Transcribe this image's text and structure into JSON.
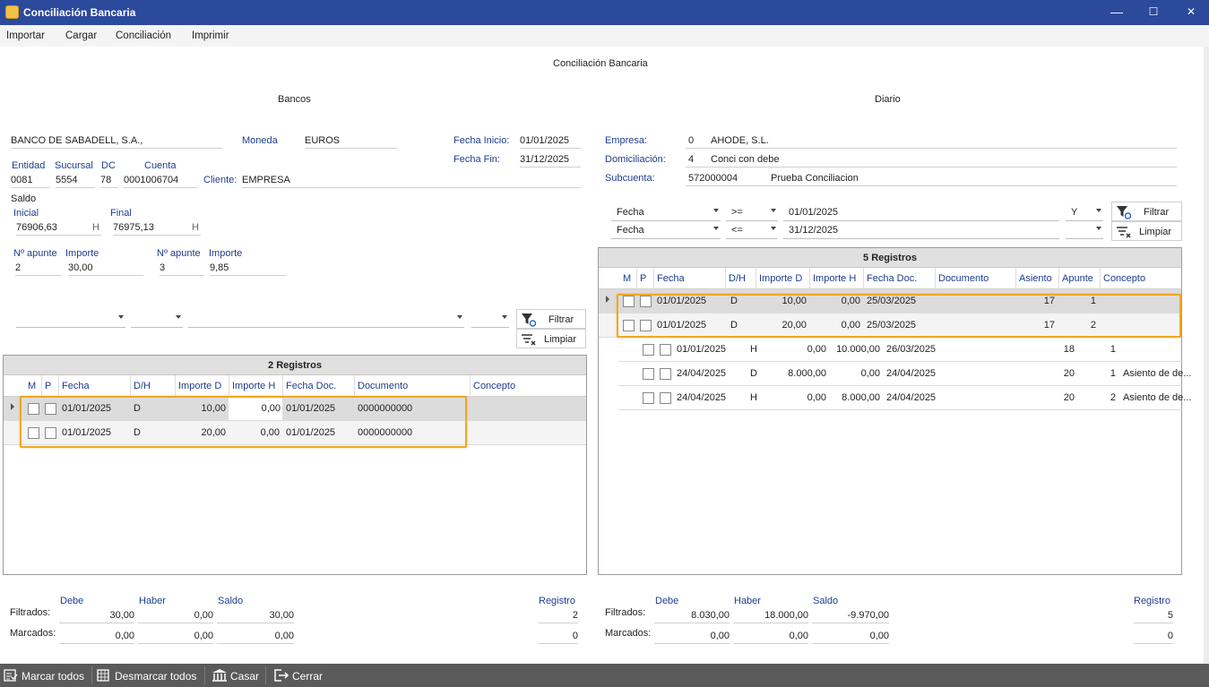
{
  "window": {
    "title": "Conciliación Bancaria",
    "minimize": "—",
    "maximize": "☐",
    "close": "✕"
  },
  "menu": [
    "Importar",
    "Cargar",
    "Conciliación",
    "Imprimir"
  ],
  "page_title": "Conciliación Bancaria",
  "bancos": {
    "section_title": "Bancos",
    "bank_name": "BANCO DE SABADELL, S.A.,",
    "moneda_label": "Moneda",
    "moneda_value": "EUROS",
    "fecha_inicio_label": "Fecha Inicio:",
    "fecha_inicio_value": "01/01/2025",
    "fecha_fin_label": "Fecha Fin:",
    "fecha_fin_value": "31/12/2025",
    "entidad_label": "Entidad",
    "entidad_value": "0081",
    "sucursal_label": "Sucursal",
    "sucursal_value": "5554",
    "dc_label": "DC",
    "dc_value": "78",
    "cuenta_label": "Cuenta",
    "cuenta_value": "0001006704",
    "cliente_label": "Cliente:",
    "cliente_value": "EMPRESA",
    "saldo_label": "Saldo",
    "inicial_label": "Inicial",
    "inicial_value": "76906,63",
    "inicial_suffix": "H",
    "final_label": "Final",
    "final_value": "76975,13",
    "final_suffix": "H",
    "napunte1_label": "Nº apunte",
    "napunte1_value": "2",
    "importe1_label": "Importe",
    "importe1_value": "30,00",
    "napunte2_label": "Nº apunte",
    "napunte2_value": "3",
    "importe2_label": "Importe",
    "importe2_value": "9,85",
    "filtrar_label": "Filtrar",
    "limpiar_label": "Limpiar",
    "grid": {
      "title": "2 Registros",
      "columns": [
        "M",
        "P",
        "Fecha",
        "D/H",
        "Importe D",
        "Importe H",
        "Fecha Doc.",
        "Documento",
        "Concepto"
      ],
      "rows": [
        {
          "fecha": "01/01/2025",
          "dh": "D",
          "importe_d": "10,00",
          "importe_h": "0,00",
          "fecha_doc": "01/01/2025",
          "documento": "0000000000",
          "concepto": ""
        },
        {
          "fecha": "01/01/2025",
          "dh": "D",
          "importe_d": "20,00",
          "importe_h": "0,00",
          "fecha_doc": "01/01/2025",
          "documento": "0000000000",
          "concepto": ""
        }
      ]
    },
    "totals": {
      "debe_label": "Debe",
      "haber_label": "Haber",
      "saldo_label": "Saldo",
      "registro_label": "Registro",
      "filtrados_label": "Filtrados:",
      "marcados_label": "Marcados:",
      "filtrados": {
        "debe": "30,00",
        "haber": "0,00",
        "saldo": "30,00",
        "registro": "2"
      },
      "marcados": {
        "debe": "0,00",
        "haber": "0,00",
        "saldo": "0,00",
        "registro": "0"
      }
    }
  },
  "diario": {
    "section_title": "Diario",
    "empresa_label": "Empresa:",
    "empresa_code": "0",
    "empresa_name": "AHODE, S.L.",
    "domiciliacion_label": "Domiciliación:",
    "domiciliacion_code": "4",
    "domiciliacion_name": "Conci con debe",
    "subcuenta_label": "Subcuenta:",
    "subcuenta_code": "572000004",
    "subcuenta_name": "Prueba Conciliacion",
    "filter1": {
      "field": "Fecha",
      "op": ">=",
      "value": "01/01/2025",
      "logic": "Y"
    },
    "filter2": {
      "field": "Fecha",
      "op": "<=",
      "value": "31/12/2025",
      "logic": ""
    },
    "filtrar_label": "Filtrar",
    "limpiar_label": "Limpiar",
    "grid": {
      "title": "5 Registros",
      "columns": [
        "M",
        "P",
        "Fecha",
        "D/H",
        "Importe D",
        "Importe H",
        "Fecha Doc.",
        "Documento",
        "Asiento",
        "Apunte",
        "Concepto"
      ],
      "rows": [
        {
          "fecha": "01/01/2025",
          "dh": "D",
          "importe_d": "10,00",
          "importe_h": "0,00",
          "fecha_doc": "25/03/2025",
          "documento": "",
          "asiento": "17",
          "apunte": "1",
          "concepto": ""
        },
        {
          "fecha": "01/01/2025",
          "dh": "D",
          "importe_d": "20,00",
          "importe_h": "0,00",
          "fecha_doc": "25/03/2025",
          "documento": "",
          "asiento": "17",
          "apunte": "2",
          "concepto": ""
        },
        {
          "fecha": "01/01/2025",
          "dh": "H",
          "importe_d": "0,00",
          "importe_h": "10.000,00",
          "fecha_doc": "26/03/2025",
          "documento": "",
          "asiento": "18",
          "apunte": "1",
          "concepto": ""
        },
        {
          "fecha": "24/04/2025",
          "dh": "D",
          "importe_d": "8.000,00",
          "importe_h": "0,00",
          "fecha_doc": "24/04/2025",
          "documento": "",
          "asiento": "20",
          "apunte": "1",
          "concepto": "Asiento de de..."
        },
        {
          "fecha": "24/04/2025",
          "dh": "H",
          "importe_d": "0,00",
          "importe_h": "8.000,00",
          "fecha_doc": "24/04/2025",
          "documento": "",
          "asiento": "20",
          "apunte": "2",
          "concepto": "Asiento de de..."
        }
      ]
    },
    "totals": {
      "debe_label": "Debe",
      "haber_label": "Haber",
      "saldo_label": "Saldo",
      "registro_label": "Registro",
      "filtrados_label": "Filtrados:",
      "marcados_label": "Marcados:",
      "filtrados": {
        "debe": "8.030,00",
        "haber": "18.000,00",
        "saldo": "-9.970,00",
        "registro": "5"
      },
      "marcados": {
        "debe": "0,00",
        "haber": "0,00",
        "saldo": "0,00",
        "registro": "0"
      }
    }
  },
  "toolbar": {
    "marcar_todos": "Marcar todos",
    "desmarcar_todos": "Desmarcar todos",
    "casar": "Casar",
    "cerrar": "Cerrar"
  },
  "colors": {
    "titlebar": "#2b4a9c",
    "label_blue": "#1f3d8f",
    "highlight": "#f0a820",
    "bottombar": "#5a5a5a"
  }
}
